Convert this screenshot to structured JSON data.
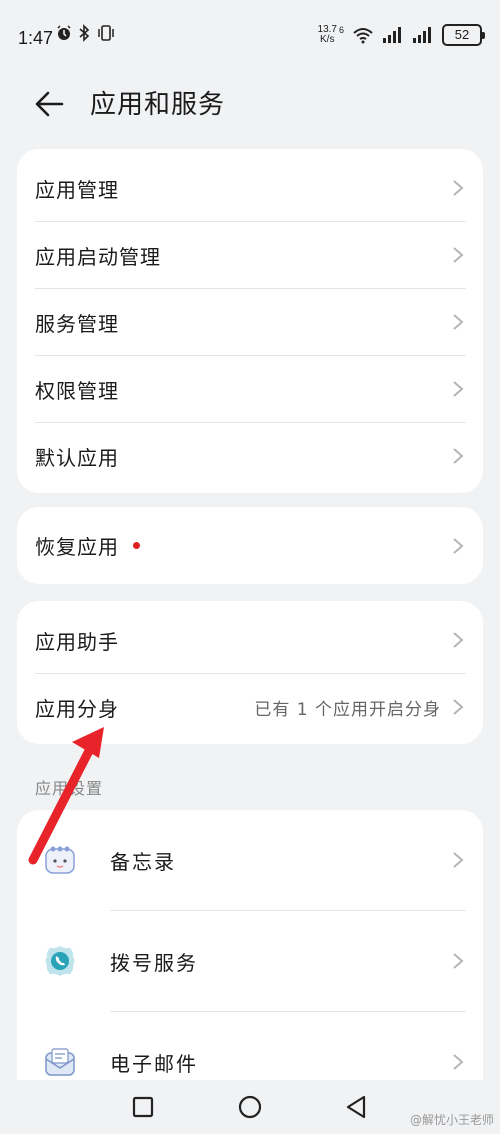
{
  "status_bar": {
    "time": "1:47",
    "speed_value": "13.7",
    "speed_unit": "K/s",
    "network_badge": "6",
    "battery": "52",
    "icons": [
      "alarm-icon",
      "bluetooth-icon",
      "vibrate-icon",
      "wifi-icon",
      "signal-icon",
      "signal-icon",
      "battery-icon"
    ]
  },
  "header": {
    "title": "应用和服务",
    "back_icon": "back-arrow-icon"
  },
  "group1": {
    "items": [
      {
        "label": "应用管理"
      },
      {
        "label": "应用启动管理"
      },
      {
        "label": "服务管理"
      },
      {
        "label": "权限管理"
      },
      {
        "label": "默认应用"
      }
    ]
  },
  "group2": {
    "items": [
      {
        "label": "恢复应用",
        "badge": "red-dot"
      }
    ]
  },
  "group3": {
    "items": [
      {
        "label": "应用助手"
      },
      {
        "label": "应用分身",
        "subtitle": "已有 1 个应用开启分身"
      }
    ]
  },
  "app_settings": {
    "section_label": "应用设置",
    "items": [
      {
        "label": "备忘录",
        "icon": "memo-icon"
      },
      {
        "label": "拨号服务",
        "icon": "phone-icon"
      },
      {
        "label": "电子邮件",
        "icon": "email-icon"
      }
    ]
  },
  "navbar": {
    "buttons": [
      "recents-icon",
      "home-icon",
      "back-triangle-icon"
    ],
    "watermark": "@解忧小王老师"
  },
  "colors": {
    "background": "#f1f2f4",
    "card": "#ffffff",
    "badge": "#e02020",
    "annotation_arrow": "#e8242a"
  }
}
